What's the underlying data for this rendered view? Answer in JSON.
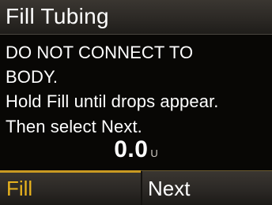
{
  "header": {
    "title": "Fill Tubing"
  },
  "instructions": {
    "line1": "DO NOT CONNECT TO",
    "line2": "BODY.",
    "line3": "Hold Fill until drops appear.",
    "line4": "Then select Next."
  },
  "readout": {
    "value": "0.0",
    "unit": "U"
  },
  "softkeys": {
    "left_label": "Fill",
    "right_label": "Next"
  },
  "colors": {
    "background": "#050403",
    "header_bar": "#2c2925",
    "accent_selected": "#e8b21e",
    "text": "#ffffff"
  }
}
